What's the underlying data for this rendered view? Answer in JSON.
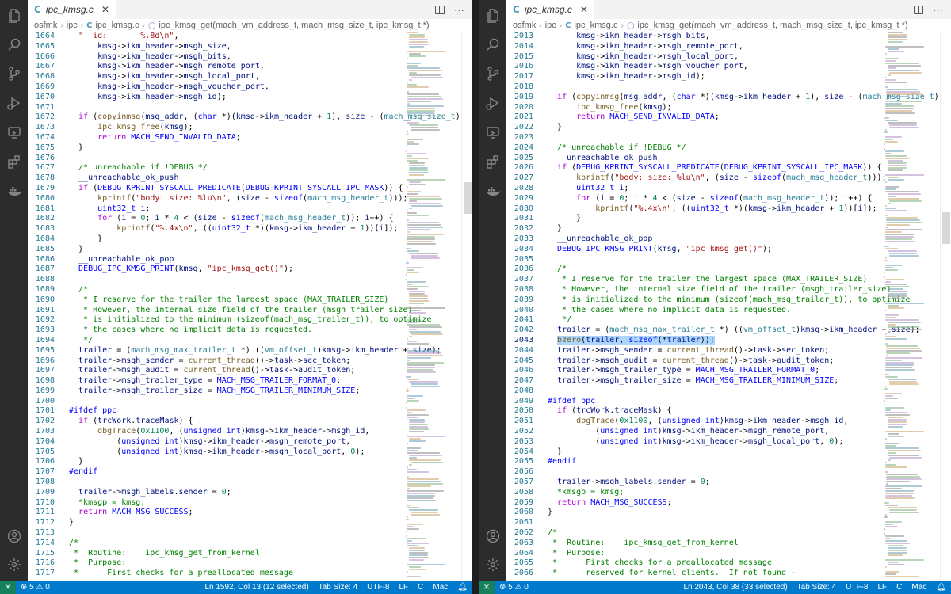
{
  "colors": {
    "statusbar": "#007acc",
    "activitybar": "#2c2c2c",
    "remote": "#16825d"
  },
  "activity_icons": [
    "files-icon",
    "search-icon",
    "source-control-icon",
    "run-debug-icon",
    "remote-explorer-icon",
    "extensions-icon",
    "docker-icon"
  ],
  "panes": [
    {
      "tab": {
        "label": "ipc_kmsg.c",
        "close": "✕"
      },
      "tab_actions": {
        "more": "···"
      },
      "breadcrumb": {
        "folder": "osfmk",
        "folder2": "ipc",
        "file": "ipc_kmsg.c",
        "symbol": "ipc_kmsg_get(mach_vm_address_t, mach_msg_size_t, ipc_kmsg_t *)"
      },
      "status": {
        "problems": "⊗ 5 ⚠ 0",
        "position": "Ln 1592, Col 13 (12 selected)",
        "tabsize": "Tab Size: 4",
        "encoding": "UTF-8",
        "eol": "LF",
        "lang": "C",
        "platform": "Mac",
        "bell": "🔔"
      },
      "lines": [
        {
          "n": "1664",
          "code": "  \"  id:       %.8d\\n\","
        },
        {
          "n": "1665",
          "code": "      kmsg->ikm_header->msgh_size,"
        },
        {
          "n": "1666",
          "code": "      kmsg->ikm_header->msgh_bits,"
        },
        {
          "n": "1667",
          "code": "      kmsg->ikm_header->msgh_remote_port,"
        },
        {
          "n": "1668",
          "code": "      kmsg->ikm_header->msgh_local_port,"
        },
        {
          "n": "1669",
          "code": "      kmsg->ikm_header->msgh_voucher_port,"
        },
        {
          "n": "1670",
          "code": "      kmsg->ikm_header->msgh_id);"
        },
        {
          "n": "1671",
          "code": ""
        },
        {
          "n": "1672",
          "code": "  if (copyinmsg(msg_addr, (char *)(kmsg->ikm_header + 1), size - (mach_msg_size_t)"
        },
        {
          "n": "1673",
          "code": "      ipc_kmsg_free(kmsg);"
        },
        {
          "n": "1674",
          "code": "      return MACH_SEND_INVALID_DATA;"
        },
        {
          "n": "1675",
          "code": "  }"
        },
        {
          "n": "1676",
          "code": ""
        },
        {
          "n": "1677",
          "code": "  /* unreachable if !DEBUG */"
        },
        {
          "n": "1678",
          "code": "  __unreachable_ok_push"
        },
        {
          "n": "1679",
          "code": "  if (DEBUG_KPRINT_SYSCALL_PREDICATE(DEBUG_KPRINT_SYSCALL_IPC_MASK)) {"
        },
        {
          "n": "1680",
          "code": "      kprintf(\"body: size: %lu\\n\", (size - sizeof(mach_msg_header_t)));"
        },
        {
          "n": "1681",
          "code": "      uint32_t i;"
        },
        {
          "n": "1682",
          "code": "      for (i = 0; i * 4 < (size - sizeof(mach_msg_header_t)); i++) {"
        },
        {
          "n": "1683",
          "code": "          kprintf(\"%.4x\\n\", ((uint32_t *)(kmsg->ikm_header + 1))[i]);"
        },
        {
          "n": "1684",
          "code": "      }"
        },
        {
          "n": "1685",
          "code": "  }"
        },
        {
          "n": "1686",
          "code": "  __unreachable_ok_pop"
        },
        {
          "n": "1687",
          "code": "  DEBUG_IPC_KMSG_PRINT(kmsg, \"ipc_kmsg_get()\");"
        },
        {
          "n": "1688",
          "code": ""
        },
        {
          "n": "1689",
          "code": "  /*"
        },
        {
          "n": "1690",
          "code": "   * I reserve for the trailer the largest space (MAX_TRAILER_SIZE)"
        },
        {
          "n": "1691",
          "code": "   * However, the internal size field of the trailer (msgh_trailer_size)"
        },
        {
          "n": "1692",
          "code": "   * is initialized to the minimum (sizeof(mach_msg_trailer_t)), to optimize"
        },
        {
          "n": "1693",
          "code": "   * the cases where no implicit data is requested."
        },
        {
          "n": "1694",
          "code": "   */"
        },
        {
          "n": "1695",
          "code": "  trailer = (mach_msg_max_trailer_t *) ((vm_offset_t)kmsg->ikm_header + size);"
        },
        {
          "n": "1696",
          "code": "  trailer->msgh_sender = current_thread()->task->sec_token;"
        },
        {
          "n": "1697",
          "code": "  trailer->msgh_audit = current_thread()->task->audit_token;"
        },
        {
          "n": "1698",
          "code": "  trailer->msgh_trailer_type = MACH_MSG_TRAILER_FORMAT_0;"
        },
        {
          "n": "1699",
          "code": "  trailer->msgh_trailer_size = MACH_MSG_TRAILER_MINIMUM_SIZE;"
        },
        {
          "n": "1700",
          "code": ""
        },
        {
          "n": "1701",
          "code": "#ifdef ppc"
        },
        {
          "n": "1702",
          "code": "  if (trcWork.traceMask) {"
        },
        {
          "n": "1703",
          "code": "      dbgTrace(0x1100, (unsigned int)kmsg->ikm_header->msgh_id,"
        },
        {
          "n": "1704",
          "code": "          (unsigned int)kmsg->ikm_header->msgh_remote_port,"
        },
        {
          "n": "1705",
          "code": "          (unsigned int)kmsg->ikm_header->msgh_local_port, 0);"
        },
        {
          "n": "1706",
          "code": "  }"
        },
        {
          "n": "1707",
          "code": "#endif"
        },
        {
          "n": "1708",
          "code": ""
        },
        {
          "n": "1709",
          "code": "  trailer->msgh_labels.sender = 0;"
        },
        {
          "n": "1710",
          "code": "  *kmsgp = kmsg;"
        },
        {
          "n": "1711",
          "code": "  return MACH_MSG_SUCCESS;"
        },
        {
          "n": "1712",
          "code": "}"
        },
        {
          "n": "1713",
          "code": ""
        },
        {
          "n": "1714",
          "code": "/*"
        },
        {
          "n": "1715",
          "code": " *  Routine:    ipc_kmsg_get_from_kernel"
        },
        {
          "n": "1716",
          "code": " *  Purpose:"
        },
        {
          "n": "1717",
          "code": " *      First checks for a preallocated message"
        }
      ]
    },
    {
      "tab": {
        "label": "ipc_kmsg.c",
        "close": "✕"
      },
      "tab_actions": {
        "more": "···"
      },
      "breadcrumb": {
        "folder": "osfmk",
        "folder2": "ipc",
        "file": "ipc_kmsg.c",
        "symbol": "ipc_kmsg_get(mach_vm_address_t, mach_msg_size_t, ipc_kmsg_t *)"
      },
      "status": {
        "problems": "⊗ 5 ⚠ 0",
        "position": "Ln 2043, Col 38 (33 selected)",
        "tabsize": "Tab Size: 4",
        "encoding": "UTF-8",
        "eol": "LF",
        "lang": "C",
        "platform": "Mac",
        "bell": "🔔"
      },
      "lines": [
        {
          "n": "2013",
          "code": "      kmsg->ikm_header->msgh_bits,"
        },
        {
          "n": "2014",
          "code": "      kmsg->ikm_header->msgh_remote_port,"
        },
        {
          "n": "2015",
          "code": "      kmsg->ikm_header->msgh_local_port,"
        },
        {
          "n": "2016",
          "code": "      kmsg->ikm_header->msgh_voucher_port,"
        },
        {
          "n": "2017",
          "code": "      kmsg->ikm_header->msgh_id);"
        },
        {
          "n": "2018",
          "code": ""
        },
        {
          "n": "2019",
          "code": "  if (copyinmsg(msg_addr, (char *)(kmsg->ikm_header + 1), size - (mach_msg_size_t)"
        },
        {
          "n": "2020",
          "code": "      ipc_kmsg_free(kmsg);"
        },
        {
          "n": "2021",
          "code": "      return MACH_SEND_INVALID_DATA;"
        },
        {
          "n": "2022",
          "code": "  }"
        },
        {
          "n": "2023",
          "code": ""
        },
        {
          "n": "2024",
          "code": "  /* unreachable if !DEBUG */"
        },
        {
          "n": "2025",
          "code": "  __unreachable_ok_push"
        },
        {
          "n": "2026",
          "code": "  if (DEBUG_KPRINT_SYSCALL_PREDICATE(DEBUG_KPRINT_SYSCALL_IPC_MASK)) {"
        },
        {
          "n": "2027",
          "code": "      kprintf(\"body: size: %lu\\n\", (size - sizeof(mach_msg_header_t)));"
        },
        {
          "n": "2028",
          "code": "      uint32_t i;"
        },
        {
          "n": "2029",
          "code": "      for (i = 0; i * 4 < (size - sizeof(mach_msg_header_t)); i++) {"
        },
        {
          "n": "2030",
          "code": "          kprintf(\"%.4x\\n\", ((uint32_t *)(kmsg->ikm_header + 1))[i]);"
        },
        {
          "n": "2031",
          "code": "      }"
        },
        {
          "n": "2032",
          "code": "  }"
        },
        {
          "n": "2033",
          "code": "  __unreachable_ok_pop"
        },
        {
          "n": "2034",
          "code": "  DEBUG_IPC_KMSG_PRINT(kmsg, \"ipc_kmsg_get()\");"
        },
        {
          "n": "2035",
          "code": ""
        },
        {
          "n": "2036",
          "code": "  /*"
        },
        {
          "n": "2037",
          "code": "   * I reserve for the trailer the largest space (MAX_TRAILER_SIZE)"
        },
        {
          "n": "2038",
          "code": "   * However, the internal size field of the trailer (msgh_trailer_size)"
        },
        {
          "n": "2039",
          "code": "   * is initialized to the minimum (sizeof(mach_msg_trailer_t)), to optimize"
        },
        {
          "n": "2040",
          "code": "   * the cases where no implicit data is requested."
        },
        {
          "n": "2041",
          "code": "   */"
        },
        {
          "n": "2042",
          "code": "  trailer = (mach_msg_max_trailer_t *) ((vm_offset_t)kmsg->ikm_header + size);"
        },
        {
          "n": "2043",
          "code": "  bzero(trailer, sizeof(*trailer));",
          "selected": true
        },
        {
          "n": "2044",
          "code": "  trailer->msgh_sender = current_thread()->task->sec_token;"
        },
        {
          "n": "2045",
          "code": "  trailer->msgh_audit = current_thread()->task->audit_token;"
        },
        {
          "n": "2046",
          "code": "  trailer->msgh_trailer_type = MACH_MSG_TRAILER_FORMAT_0;"
        },
        {
          "n": "2047",
          "code": "  trailer->msgh_trailer_size = MACH_MSG_TRAILER_MINIMUM_SIZE;"
        },
        {
          "n": "2048",
          "code": ""
        },
        {
          "n": "2049",
          "code": "#ifdef ppc"
        },
        {
          "n": "2050",
          "code": "  if (trcWork.traceMask) {"
        },
        {
          "n": "2051",
          "code": "      dbgTrace(0x1100, (unsigned int)kmsg->ikm_header->msgh_id,"
        },
        {
          "n": "2052",
          "code": "          (unsigned int)kmsg->ikm_header->msgh_remote_port,"
        },
        {
          "n": "2053",
          "code": "          (unsigned int)kmsg->ikm_header->msgh_local_port, 0);"
        },
        {
          "n": "2054",
          "code": "  }"
        },
        {
          "n": "2055",
          "code": "#endif"
        },
        {
          "n": "2056",
          "code": ""
        },
        {
          "n": "2057",
          "code": "  trailer->msgh_labels.sender = 0;"
        },
        {
          "n": "2058",
          "code": "  *kmsgp = kmsg;"
        },
        {
          "n": "2059",
          "code": "  return MACH_MSG_SUCCESS;"
        },
        {
          "n": "2060",
          "code": "}"
        },
        {
          "n": "2061",
          "code": ""
        },
        {
          "n": "2062",
          "code": "/*"
        },
        {
          "n": "2063",
          "code": " *  Routine:    ipc_kmsg_get_from_kernel"
        },
        {
          "n": "2064",
          "code": " *  Purpose:"
        },
        {
          "n": "2065",
          "code": " *      First checks for a preallocated message"
        },
        {
          "n": "2066",
          "code": " *      reserved for kernel clients.  If not found -"
        }
      ]
    }
  ]
}
